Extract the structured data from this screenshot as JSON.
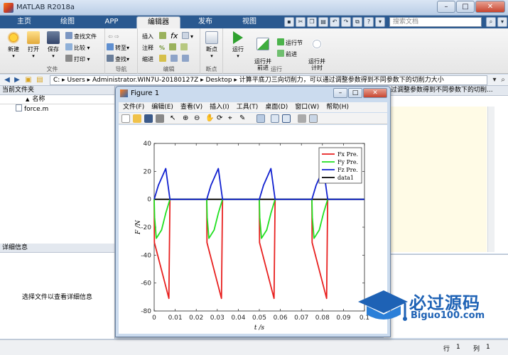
{
  "app": {
    "title": "MATLAB R2018a"
  },
  "window_controls": {
    "minimize": "–",
    "maximize": "□",
    "close": "✕"
  },
  "tabs": [
    {
      "label": "主页"
    },
    {
      "label": "绘图"
    },
    {
      "label": "APP"
    },
    {
      "label": "编辑器",
      "active": true
    },
    {
      "label": "发布"
    },
    {
      "label": "视图"
    }
  ],
  "search": {
    "placeholder": "搜索文档"
  },
  "ribbon": {
    "file": {
      "group_label": "文件",
      "new": "新建",
      "open": "打开",
      "save": "保存",
      "find_files": "查找文件",
      "compare": "比较",
      "print": "打印"
    },
    "navigate": {
      "group_label": "导航",
      "goto": "转至",
      "find": "查找"
    },
    "edit": {
      "group_label": "编辑",
      "insert": "插入",
      "comment": "注释",
      "indent": "缩进",
      "fx": "fx"
    },
    "breakpoints": {
      "group_label": "断点",
      "breakpoints": "断点"
    },
    "run": {
      "group_label": "运行",
      "run": "运行",
      "run_advance": "运行并\n前进",
      "run_section": "运行节",
      "advance": "前进",
      "run_time": "运行并\n计时"
    }
  },
  "address": {
    "path": "C: ▸ Users ▸ Administrator.WIN7U-20180127Z ▸ Desktop ▸ 计算平底刀三向切削力，可以通过调整参数得到不同参数下的切削力大小"
  },
  "current_folder": {
    "title": "当前文件夹",
    "column_name": "名称",
    "sort_indicator": "▲",
    "files": [
      {
        "name": "force.m"
      }
    ]
  },
  "details": {
    "title": "详细信息",
    "message": "选择文件以查看详细信息"
  },
  "editor": {
    "tab_text": "过调整参数得到不同参数下的切削..."
  },
  "status": {
    "row_label": "行",
    "row_value": "1",
    "col_label": "列",
    "col_value": "1"
  },
  "figure": {
    "title": "Figure 1",
    "menu": [
      "文件(F)",
      "编辑(E)",
      "查看(V)",
      "插入(I)",
      "工具(T)",
      "桌面(D)",
      "窗口(W)",
      "帮助(H)"
    ]
  },
  "watermark": {
    "title": "必过源码",
    "subtitle": "Biguo100.com"
  },
  "colors": {
    "fx": "#e8201f",
    "fy": "#20e020",
    "fz": "#1020d0",
    "data1": "#000000"
  },
  "chart_data": {
    "type": "line",
    "xlabel": "t /s",
    "ylabel": "F /N",
    "xlim": [
      0,
      0.1
    ],
    "ylim": [
      -80,
      40
    ],
    "xticks": [
      0,
      0.01,
      0.02,
      0.03,
      0.04,
      0.05,
      0.06,
      0.07,
      0.08,
      0.09,
      0.1
    ],
    "yticks": [
      -80,
      -60,
      -40,
      -20,
      0,
      20,
      40
    ],
    "xtick_labels": [
      "0",
      "0.01",
      "0.02",
      "0.03",
      "0.04",
      "0.05",
      "0.06",
      "0.07",
      "0.08",
      "0.09",
      "0.1"
    ],
    "ytick_labels": [
      "-80",
      "-60",
      "-40",
      "-20",
      "0",
      "20",
      "40"
    ],
    "legend_position": "top-right",
    "grid": false,
    "series": [
      {
        "name": "Fx Pre.",
        "color": "#e8201f",
        "x": [
          0,
          0.0001,
          0.007,
          0.0075,
          0.025,
          0.0251,
          0.032,
          0.0325,
          0.05,
          0.0501,
          0.057,
          0.0575,
          0.075,
          0.0751,
          0.082,
          0.0825,
          0.1
        ],
        "y": [
          0,
          -31,
          -71,
          0,
          0,
          -31,
          -71,
          0,
          0,
          -31,
          -71,
          0,
          0,
          -31,
          -71,
          0,
          0
        ]
      },
      {
        "name": "Fy Pre.",
        "color": "#20e020",
        "x": [
          0,
          0.0002,
          0.001,
          0.0035,
          0.0055,
          0.0075,
          0.025,
          0.0252,
          0.026,
          0.0285,
          0.0305,
          0.0325,
          0.05,
          0.0502,
          0.051,
          0.0535,
          0.0555,
          0.0575,
          0.075,
          0.0752,
          0.076,
          0.0785,
          0.0805,
          0.0825,
          0.1
        ],
        "y": [
          0,
          -13,
          -28,
          -22,
          -10,
          0,
          0,
          -13,
          -28,
          -22,
          -10,
          0,
          0,
          -13,
          -28,
          -22,
          -10,
          0,
          0,
          -13,
          -28,
          -22,
          -10,
          0,
          0
        ]
      },
      {
        "name": "Fz Pre.",
        "color": "#1020d0",
        "x": [
          0,
          0.002,
          0.0055,
          0.0075,
          0.025,
          0.027,
          0.0305,
          0.0325,
          0.05,
          0.052,
          0.0555,
          0.0575,
          0.075,
          0.077,
          0.0805,
          0.0825,
          0.1
        ],
        "y": [
          0,
          10,
          22,
          0,
          0,
          10,
          22,
          0,
          0,
          10,
          22,
          0,
          0,
          10,
          22,
          0,
          0
        ]
      },
      {
        "name": "data1",
        "color": "#000000",
        "x": [
          0,
          0.1
        ],
        "y": [
          0,
          0
        ]
      }
    ]
  }
}
